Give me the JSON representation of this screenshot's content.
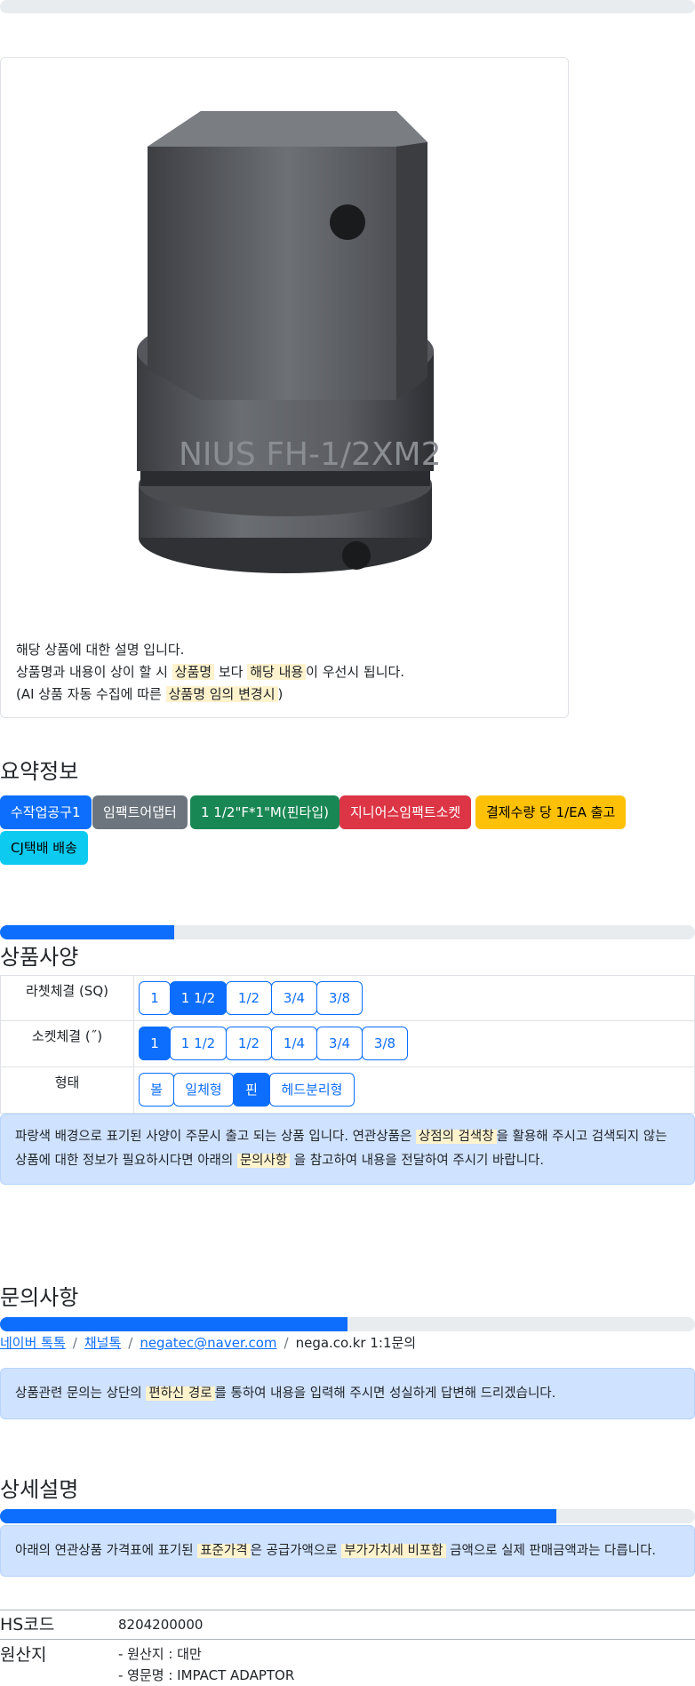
{
  "product": {
    "image_alt": "FH-1/2XM2-4 임팩트 어댑터",
    "description_line1": "해당 상품에 대한 설명 입니다.",
    "description_line2_a": "상품명과 내용이 상이 할 시 ",
    "description_line2_mark1": "상품명",
    "description_line2_b": " 보다 ",
    "description_line2_mark2": "해당 내용",
    "description_line2_c": "이 우선시 됩니다.",
    "description_line3_a": "(AI 상품 자동 수집에 따른 ",
    "description_line3_mark": "상품명 임의 변경시",
    "description_line3_b": ")"
  },
  "summary": {
    "title": "요약정보",
    "badges": [
      {
        "label": "수작업공구1",
        "bg": "#0d6efd",
        "color": "#ffffff"
      },
      {
        "label": "임팩트어댑터",
        "bg": "#6c757d",
        "color": "#ffffff"
      },
      {
        "label": "1 1/2\"F*1\"M(핀타입)",
        "bg": "#198754",
        "color": "#ffffff"
      },
      {
        "label": "지니어스임팩트소켓",
        "bg": "#dc3545",
        "color": "#ffffff"
      },
      {
        "label": "결제수량 당 1/EA 출고",
        "bg": "#ffc107",
        "color": "#000000"
      },
      {
        "label": "CJ택배 배송",
        "bg": "#0dcaf0",
        "color": "#000000"
      }
    ]
  },
  "specs": {
    "title": "상품사양",
    "progress": 0.25,
    "rows": [
      {
        "label": "라쳇체결 (SQ)",
        "options": [
          "1",
          "1 1/2",
          "1/2",
          "3/4",
          "3/8"
        ],
        "active": 1
      },
      {
        "label": "소켓체결 (˝)",
        "options": [
          "1",
          "1 1/2",
          "1/2",
          "1/4",
          "3/4",
          "3/8"
        ],
        "active": 0
      },
      {
        "label": "형태",
        "options": [
          "볼",
          "일체형",
          "핀",
          "헤드분리형"
        ],
        "active": 2
      }
    ],
    "notice_a": "파랑색 배경으로 표기된 사양이 주문시 출고 되는 상품 입니다. 연관상품은 ",
    "notice_mark1": "상점의 검색창",
    "notice_b": "을 활용해 주시고 검색되지 않는 상품에 대한 정보가 필요하시다면 아래의 ",
    "notice_mark2": "문의사항",
    "notice_c": " 을 참고하여 내용을 전달하여 주시기 바랍니다."
  },
  "inquiry": {
    "title": "문의사항",
    "progress": 0.5,
    "links": [
      "네이버 톡톡",
      "채널톡",
      "negatec@naver.com"
    ],
    "plain": "nega.co.kr 1:1문의",
    "separator": "/",
    "notice_a": "상품관련 문의는 상단의 ",
    "notice_mark": "편하신 경로",
    "notice_b": "를 통하여 내용을 입력해 주시면 성실하게 답변해 드리겠습니다."
  },
  "detail": {
    "title": "상세설명",
    "progress": 0.8,
    "notice_a": "아래의 연관상품 가격표에 표기된 ",
    "notice_mark1": "표준가격",
    "notice_b": "은 공급가액으로 ",
    "notice_mark2": "부가가치세 비포함",
    "notice_c": " 금액으로 실제 판매금액과는 다릅니다.",
    "hs_key": "HS코드",
    "hs_value": "8204200000",
    "origin_key": "원산지",
    "origin_line1": "- 원산지 : 대만",
    "origin_line2": "- 영문명 : IMPACT ADAPTOR"
  }
}
